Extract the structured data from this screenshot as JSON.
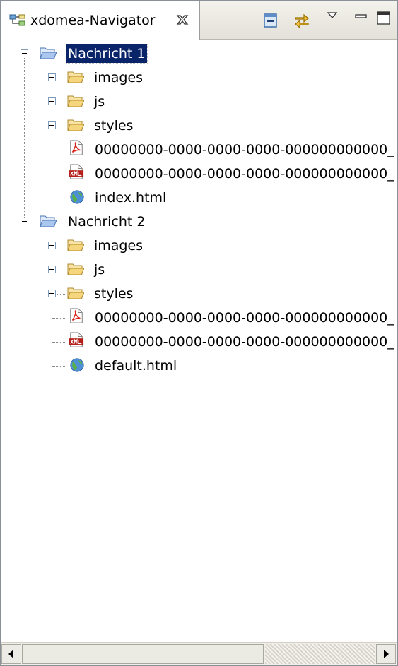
{
  "view": {
    "title": "xdomea-Navigator"
  },
  "toolbar": {
    "icons": [
      "collapse-all-icon",
      "link-with-editor-icon",
      "view-menu-icon",
      "minimize-icon",
      "maximize-icon"
    ]
  },
  "tree": {
    "n1": {
      "label": "Nachricht 1",
      "images": "images",
      "js": "js",
      "styles": "styles",
      "pdf": "00000000-0000-0000-0000-000000000000_",
      "xml": "00000000-0000-0000-0000-000000000000_",
      "html": "index.html"
    },
    "n2": {
      "label": "Nachricht 2",
      "images": "images",
      "js": "js",
      "styles": "styles",
      "pdf": "00000000-0000-0000-0000-000000000000_",
      "xml": "00000000-0000-0000-0000-000000000000_",
      "html": "default.html"
    }
  },
  "colors": {
    "selection": "#0a246a",
    "folder": "#f6d67c",
    "pdf": "#d8241c",
    "xml": "#b51f1a"
  }
}
